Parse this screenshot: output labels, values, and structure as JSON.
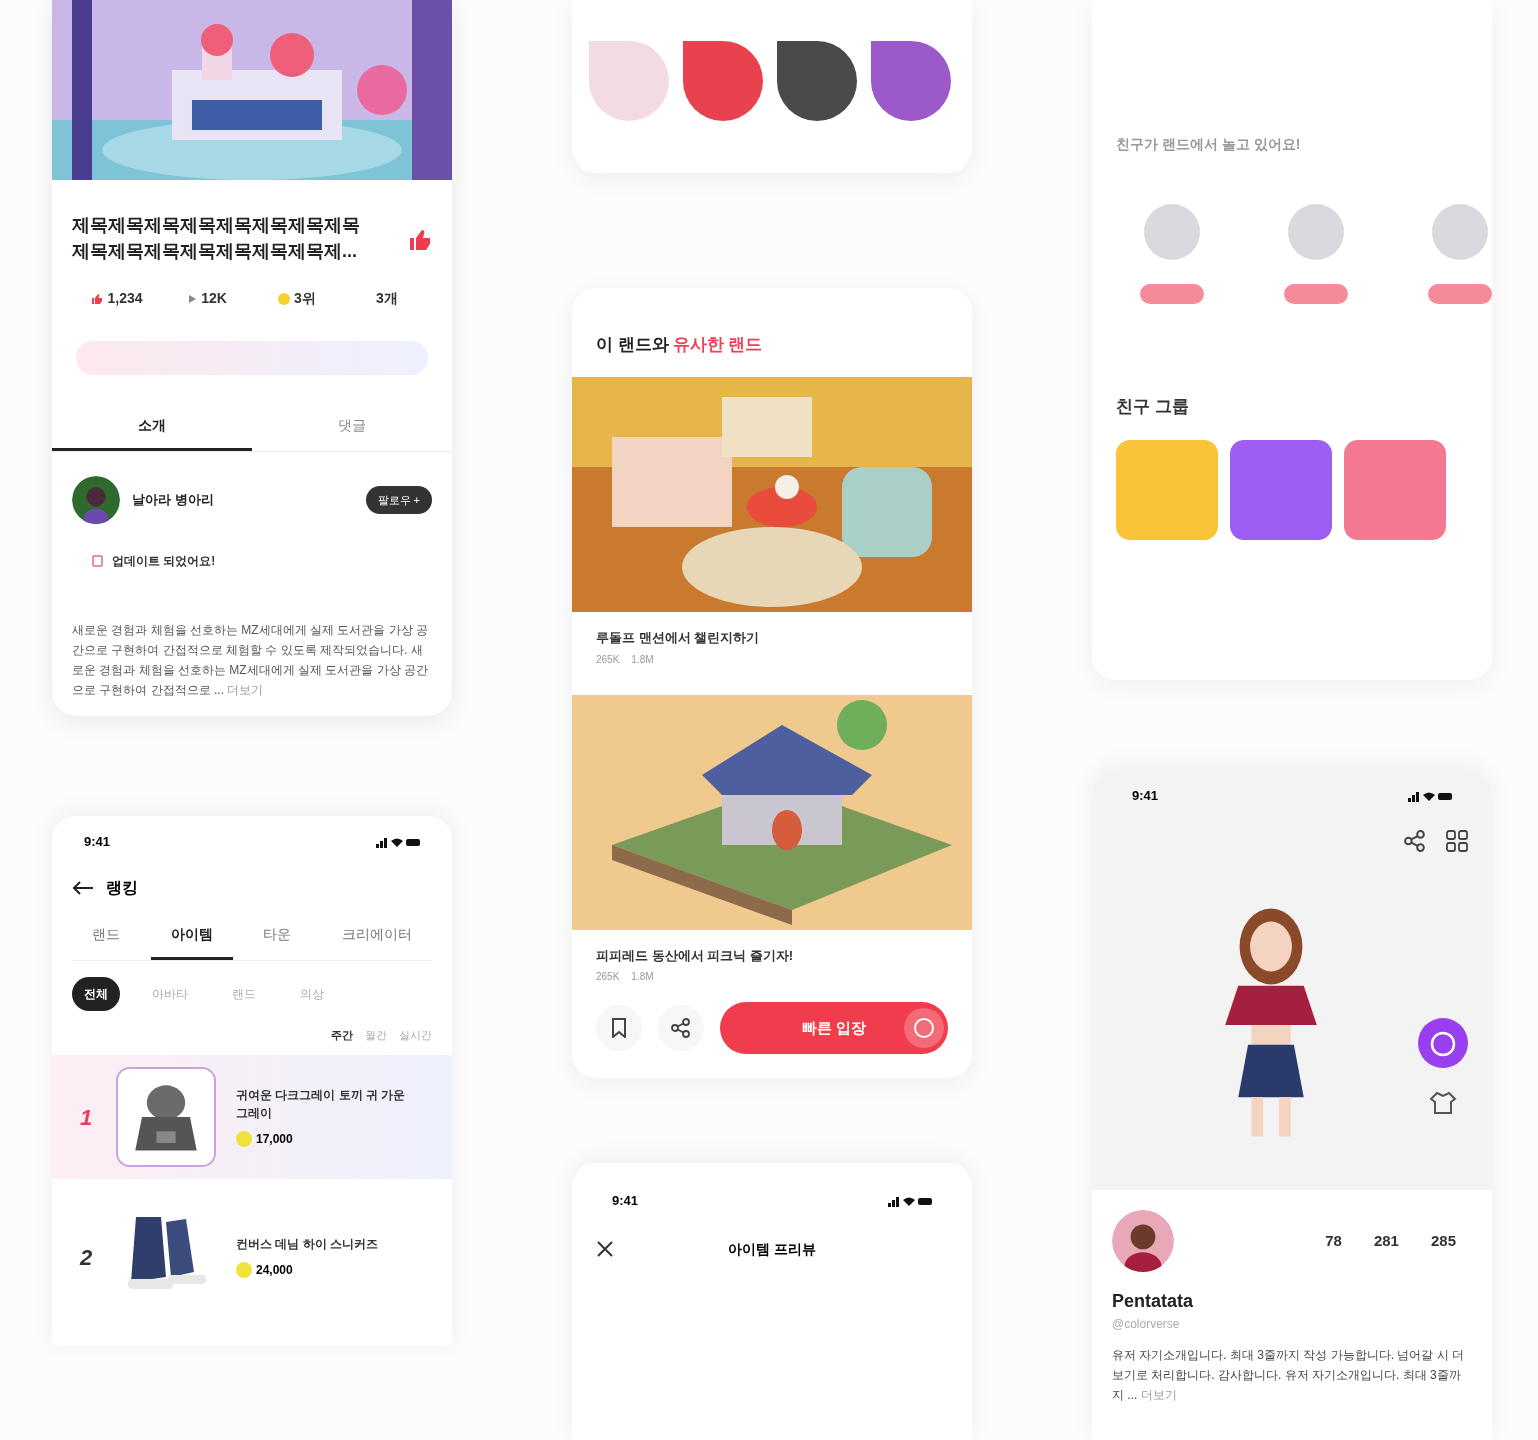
{
  "land_detail": {
    "title": "제목제목제목제목제목제목제목제목 제목제목제목제목제목제목제목제...",
    "liked": true,
    "stats": [
      {
        "kind": "likes",
        "value": "1,234"
      },
      {
        "kind": "visits",
        "value": "12K"
      },
      {
        "kind": "rank",
        "value": "3위"
      },
      {
        "kind": "plain",
        "value": "3개"
      }
    ],
    "tabs": [
      {
        "label": "소개",
        "selected": true
      },
      {
        "label": "댓글",
        "selected": false
      }
    ],
    "creator": {
      "name": "날아라 병아리",
      "follow": "팔로우 +"
    },
    "update": "업데이트 되었어요!",
    "description": "새로운 경험과 체험을 선호하는 MZ세대에게 실제 도서관을 가상 공간으로 구현하여 간접적으로 체험할 수 있도록 제작되었습니다. 새로운 경험과 체험을 선호하는 MZ세대에게 실제 도서관을 가상 공간으로 구현하여 간접적으로 ...",
    "more": "더보기"
  },
  "ranking": {
    "time": "9:41",
    "title": "랭킹",
    "tabs": [
      {
        "label": "랜드",
        "selected": false
      },
      {
        "label": "아이템",
        "selected": true
      },
      {
        "label": "타운",
        "selected": false
      },
      {
        "label": "크리에이터",
        "selected": false
      }
    ],
    "chips": [
      {
        "label": "전체",
        "selected": true
      },
      {
        "label": "아바타",
        "selected": false
      },
      {
        "label": "랜드",
        "selected": false
      },
      {
        "label": "의상",
        "selected": false
      }
    ],
    "periods": [
      {
        "label": "주간",
        "selected": true
      },
      {
        "label": "월간",
        "selected": false
      },
      {
        "label": "실시간",
        "selected": false
      }
    ],
    "items": [
      {
        "rank": "1",
        "kind": "hoodie",
        "name": "귀여운 다크그레이 토끼 귀 가운 그레이",
        "price": "17,000",
        "selected": true
      },
      {
        "rank": "2",
        "kind": "sneakers",
        "name": "컨버스 데님 하이 스니커즈",
        "price": "24,000",
        "selected": false
      }
    ]
  },
  "brands": {
    "logos": [
      {
        "color": "#f3dbe3"
      },
      {
        "color": "#e9424f"
      },
      {
        "color": "#4a4a4a"
      },
      {
        "color": "#9b59c9"
      }
    ]
  },
  "similar": {
    "title_lead": "이 랜드와",
    "title_accent": "유사한 랜드",
    "items": [
      {
        "kind": "room",
        "title": "루돌프 맨션에서 챌린지하기",
        "likes": "265K",
        "visits": "1.8M"
      },
      {
        "kind": "house",
        "title": "피피레드 동산에서 피크닉 즐기자!",
        "likes": "265K",
        "visits": "1.8M"
      }
    ],
    "enter": "빠른 입장"
  },
  "preview": {
    "time": "9:41",
    "title": "아이템 프리뷰"
  },
  "friends": {
    "title": "친구가 랜드에서 놀고 있어요!"
  },
  "groups": {
    "title": "친구 그룹",
    "tiles": [
      {
        "color": "#f9c43a"
      },
      {
        "color": "#9d5cf2"
      },
      {
        "color": "#f4788f"
      }
    ]
  },
  "profile": {
    "time": "9:41",
    "stats": [
      "78",
      "281",
      "285"
    ],
    "name": "Pentatata",
    "handle": "@colorverse",
    "bio": "유저 자기소개입니다. 최대 3줄까지 작성 가능합니다. 넘어갈 시 더보기로 처리합니다. 감사합니다. 유저 자기소개입니다. 최대 3줄까지 ...",
    "more": "더보기"
  }
}
